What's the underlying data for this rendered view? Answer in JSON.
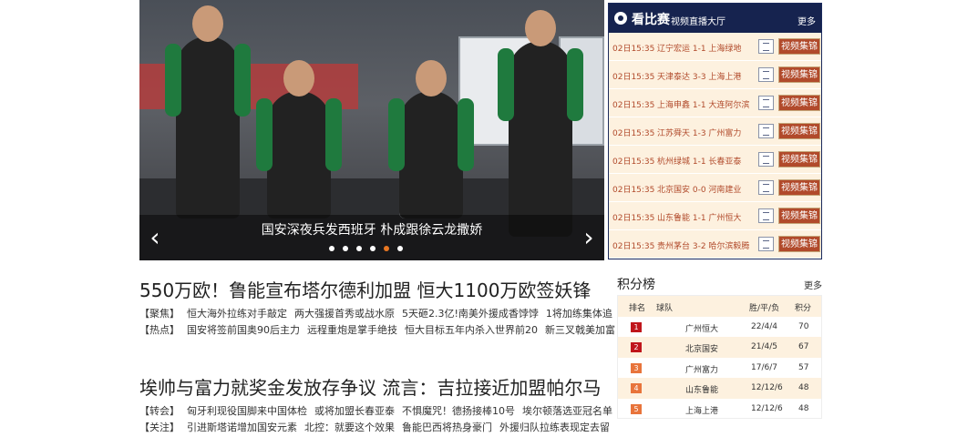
{
  "hero": {
    "caption": "国安深夜兵发西班牙 朴成跟徐云龙撒娇",
    "dots": 6,
    "active_dot": 4,
    "prev_arrow": "‹",
    "next_arrow": "›"
  },
  "matches": {
    "title": "看比赛",
    "subtitle": "视频直播大厅",
    "more": "更多",
    "video_label": "视频集锦",
    "rows": [
      {
        "time": "02日15:35",
        "teams": "辽宁宏运 1-1 上海绿地"
      },
      {
        "time": "02日15:35",
        "teams": "天津泰达 3-3 上海上港"
      },
      {
        "time": "02日15:35",
        "teams": "上海申鑫 1-1 大连阿尔滨"
      },
      {
        "time": "02日15:35",
        "teams": "江苏舜天 1-3 广州富力"
      },
      {
        "time": "02日15:35",
        "teams": "杭州绿城 1-1 长春亚泰"
      },
      {
        "time": "02日15:35",
        "teams": "北京国安 0-0 河南建业"
      },
      {
        "time": "02日15:35",
        "teams": "山东鲁能 1-1 广州恒大"
      },
      {
        "time": "02日15:35",
        "teams": "贵州茅台 3-2 哈尔滨毅腾"
      }
    ]
  },
  "news": {
    "block1": {
      "headline": "550万欧！鲁能宣布塔尔德利加盟 恒大1100万欧签妖锋",
      "lines": [
        {
          "tag": "【聚焦】",
          "links": [
            "恒大海外拉练对手敲定",
            "两大强援首秀或战水原",
            "5天砸2.3亿!南美外援成香饽饽",
            "1将加练集体追"
          ]
        },
        {
          "tag": "【热点】",
          "links": [
            "国安将签前国奥90后主力",
            "远程重炮是掌手绝技",
            "恒大目标五年内杀入世界前20",
            "新三叉戟美加富"
          ]
        }
      ]
    },
    "block2": {
      "headline": "埃帅与富力就奖金发放存争议 流言：吉拉接近加盟帕尔马",
      "lines": [
        {
          "tag": "【转会】",
          "links": [
            "匈牙利现役国脚来中国体检",
            "或将加盟长春亚泰",
            "不惧魔咒！德扬接棒10号",
            "埃尔顿落选亚冠名单"
          ]
        },
        {
          "tag": "【关注】",
          "links": [
            "引进斯塔诺增加国安元素",
            "北控：就要这个效果",
            "鲁能巴西将热身豪门",
            "外援归队拉练表现定去留"
          ]
        }
      ]
    }
  },
  "standings": {
    "title": "积分榜",
    "more": "更多",
    "headers": {
      "rank": "排名",
      "team": "球队",
      "record": "胜/平/负",
      "points": "积分"
    },
    "rank_colors": [
      "#c0161c",
      "#c0161c",
      "#e8743b",
      "#e8743b",
      "#e8743b"
    ],
    "rows": [
      {
        "rank": "1",
        "team": "广州恒大",
        "record": "22/4/4",
        "points": "70"
      },
      {
        "rank": "2",
        "team": "北京国安",
        "record": "21/4/5",
        "points": "67"
      },
      {
        "rank": "3",
        "team": "广州富力",
        "record": "17/6/7",
        "points": "57"
      },
      {
        "rank": "4",
        "team": "山东鲁能",
        "record": "12/12/6",
        "points": "48"
      },
      {
        "rank": "5",
        "team": "上海上港",
        "record": "12/12/6",
        "points": "48"
      }
    ]
  }
}
